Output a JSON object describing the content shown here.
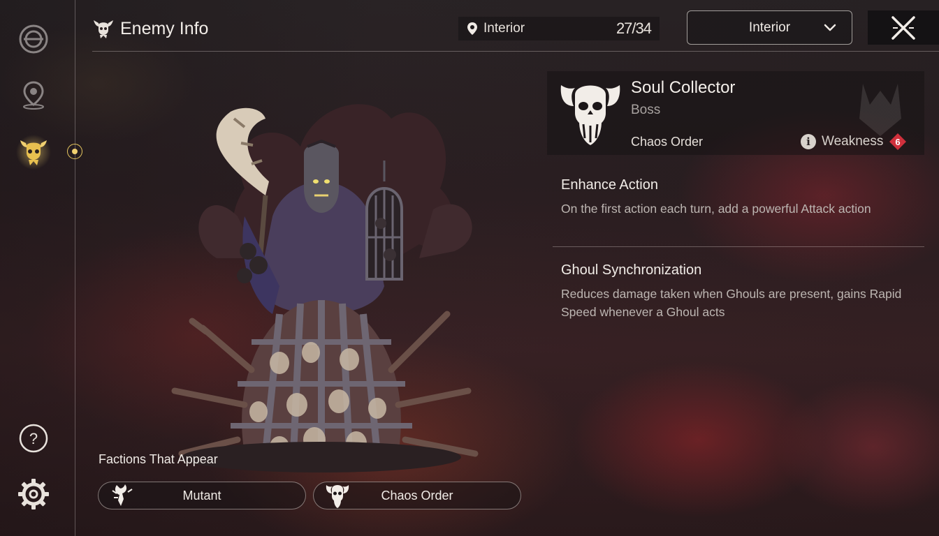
{
  "header": {
    "title": "Enemy Info",
    "location_label": "Interior",
    "location_count": "27/34",
    "dropdown_value": "Interior"
  },
  "sidebar": {
    "items": [
      {
        "name": "faction-emblem"
      },
      {
        "name": "map-pin"
      },
      {
        "name": "enemy-info",
        "active": true
      },
      {
        "name": "help"
      },
      {
        "name": "settings"
      }
    ]
  },
  "enemy": {
    "name": "Soul Collector",
    "rank": "Boss",
    "faction": "Chaos Order",
    "weakness_label": "Weakness",
    "weakness_value": "6"
  },
  "skills": [
    {
      "title": "Enhance Action",
      "description": "On the first action each turn, add a powerful Attack action"
    },
    {
      "title": "Ghoul Synchronization",
      "description": "Reduces damage taken when Ghouls are present, gains Rapid Speed whenever a Ghoul acts"
    }
  ],
  "factions": {
    "title": "Factions That Appear",
    "items": [
      {
        "label": "Mutant"
      },
      {
        "label": "Chaos Order"
      }
    ]
  },
  "colors": {
    "accent_gold": "#f0d070",
    "weakness_red": "#d0303c",
    "text_primary": "#f2ede8",
    "text_secondary": "#bdb6b2"
  }
}
